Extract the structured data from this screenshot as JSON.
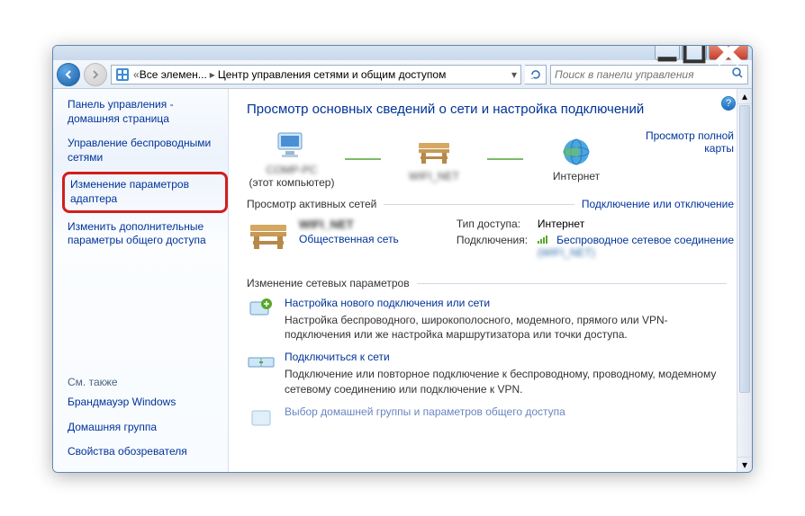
{
  "breadcrumb": {
    "root": "Все элемен...",
    "current": "Центр управления сетями и общим доступом"
  },
  "search": {
    "placeholder": "Поиск в панели управления"
  },
  "sidebar": {
    "home": "Панель управления - домашняя страница",
    "items": [
      "Управление беспроводными сетями",
      "Изменение параметров адаптера",
      "Изменить дополнительные параметры общего доступа"
    ],
    "seealso_hdr": "См. также",
    "seealso": [
      "Брандмауэр Windows",
      "Домашняя группа",
      "Свойства обозревателя"
    ]
  },
  "content": {
    "heading": "Просмотр основных сведений о сети и настройка подключений",
    "map_link": "Просмотр полной карты",
    "this_computer": "(этот компьютер)",
    "internet": "Интернет",
    "active_hdr": "Просмотр активных сетей",
    "connect_link": "Подключение или отключение",
    "public_network": "Общественная сеть",
    "access_type_lbl": "Тип доступа:",
    "access_type_val": "Интернет",
    "connections_lbl": "Подключения:",
    "wireless": "Беспроводное сетевое соединение",
    "change_hdr": "Изменение сетевых параметров",
    "tasks": [
      {
        "title": "Настройка нового подключения или сети",
        "desc": "Настройка беспроводного, широкополосного, модемного, прямого или VPN-подключения или же настройка маршрутизатора или точки доступа."
      },
      {
        "title": "Подключиться к сети",
        "desc": "Подключение или повторное подключение к беспроводному, проводному, модемному сетевому соединению или подключение к VPN."
      },
      {
        "title": "Выбор домашней группы и параметров общего доступа",
        "desc": ""
      }
    ]
  }
}
